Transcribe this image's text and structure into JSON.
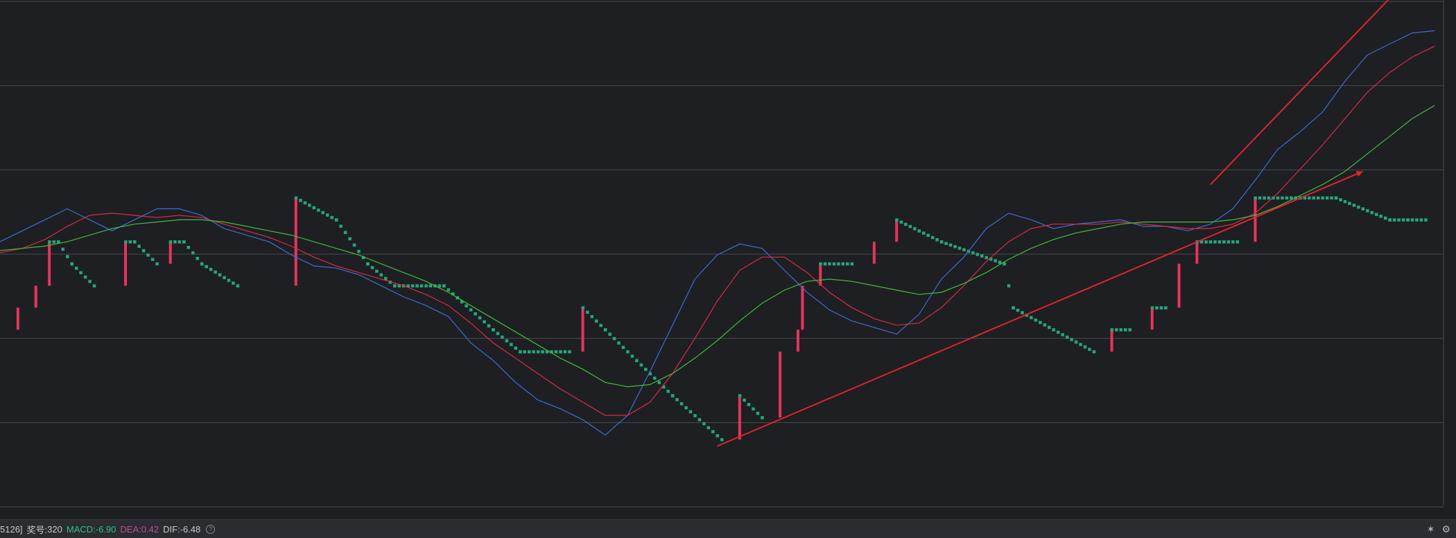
{
  "status_bar": {
    "prefix": "5126]",
    "issue_label": "奖号:",
    "issue_value": "320",
    "macd_label": "MACD:",
    "macd_value": "-6.90",
    "dea_label": "DEA:",
    "dea_value": "0.42",
    "dif_label": "DIF:",
    "dif_value": "-6.48",
    "help_glyph": "?",
    "pin_glyph": "✶",
    "settings_glyph": "⚙"
  },
  "colors": {
    "background": "#1e1f23",
    "grid": "#4a4b50",
    "up_bar": "#e8335a",
    "down_step": "#22a87c",
    "ma_fast": "#3b6fd8",
    "ma_mid": "#e02a45",
    "ma_slow": "#3fbf3a",
    "trend_line": "#e0242c"
  },
  "chart_data": {
    "type": "line",
    "title": "",
    "xlabel": "",
    "ylabel": "",
    "grid": true,
    "ylim": [
      -10,
      13
    ],
    "x": [
      0,
      5,
      10,
      15,
      20,
      25,
      30,
      35,
      40,
      45,
      50,
      55,
      60,
      65,
      70,
      75,
      80,
      85,
      90,
      95,
      100,
      105,
      110,
      115,
      120,
      125,
      130,
      135,
      140,
      145,
      150,
      155,
      160,
      165,
      170,
      175,
      180,
      185,
      190,
      195,
      200,
      205,
      210,
      215,
      220,
      225,
      230,
      235,
      240,
      245,
      250,
      255,
      260,
      265,
      270,
      275,
      280,
      285,
      290,
      295,
      300,
      305,
      310,
      315,
      320
    ],
    "series": [
      {
        "name": "",
        "values": [
          2,
          2.5,
          3,
          3.5,
          3,
          2.5,
          3,
          3.5,
          3.5,
          3.2,
          2.6,
          2.3,
          2,
          1.4,
          0.9,
          0.8,
          0.5,
          0.0,
          -0.5,
          -0.9,
          -1.4,
          -2.6,
          -3.4,
          -4.4,
          -5.2,
          -5.6,
          -6.1,
          -6.8,
          -5.9,
          -3.9,
          -1.8,
          0.3,
          1.4,
          1.9,
          1.7,
          0.7,
          -0.3,
          -1.1,
          -1.6,
          -1.9,
          -2.2,
          -1.3,
          0.3,
          1.3,
          2.6,
          3.3,
          3.0,
          2.6,
          2.8,
          2.9,
          3.0,
          2.7,
          2.7,
          2.5,
          2.8,
          3.5,
          4.8,
          6.2,
          7.0,
          7.9,
          9.3,
          10.5,
          11.0,
          11.5,
          11.6
        ]
      },
      {
        "name": "",
        "values": [
          1.5,
          1.7,
          2.1,
          2.7,
          3.2,
          3.3,
          3.2,
          3.1,
          3.2,
          3.1,
          2.8,
          2.5,
          2.2,
          1.8,
          1.3,
          0.9,
          0.6,
          0.3,
          0.0,
          -0.4,
          -0.9,
          -1.7,
          -2.6,
          -3.3,
          -4.0,
          -4.7,
          -5.3,
          -5.9,
          -5.9,
          -5.3,
          -4.0,
          -2.4,
          -0.7,
          0.7,
          1.3,
          1.3,
          0.6,
          -0.3,
          -1.0,
          -1.5,
          -1.8,
          -1.7,
          -1.0,
          0.0,
          1.1,
          2.0,
          2.6,
          2.8,
          2.8,
          2.8,
          2.9,
          2.8,
          2.7,
          2.6,
          2.6,
          2.8,
          3.3,
          4.2,
          5.3,
          6.4,
          7.6,
          8.8,
          9.7,
          10.4,
          10.9
        ]
      },
      {
        "name": "",
        "values": [
          1.6,
          1.7,
          1.8,
          2.0,
          2.3,
          2.6,
          2.8,
          2.9,
          3.0,
          3.0,
          2.9,
          2.7,
          2.5,
          2.3,
          2.0,
          1.7,
          1.4,
          1.0,
          0.6,
          0.2,
          -0.3,
          -0.9,
          -1.5,
          -2.1,
          -2.7,
          -3.3,
          -3.8,
          -4.4,
          -4.6,
          -4.5,
          -4.0,
          -3.3,
          -2.5,
          -1.6,
          -0.8,
          -0.2,
          0.2,
          0.3,
          0.2,
          0.0,
          -0.2,
          -0.4,
          -0.3,
          0.1,
          0.6,
          1.2,
          1.7,
          2.1,
          2.4,
          2.6,
          2.8,
          2.9,
          2.9,
          2.9,
          2.9,
          3.0,
          3.2,
          3.6,
          4.1,
          4.6,
          5.2,
          6.0,
          6.8,
          7.6,
          8.2
        ]
      }
    ],
    "renko": {
      "box_size": 0.5,
      "steps": [
        [
          0,
          -2
        ],
        [
          4,
          -1
        ],
        [
          8,
          0
        ],
        [
          11,
          2
        ],
        [
          13,
          2
        ],
        [
          16,
          1
        ],
        [
          21,
          0
        ],
        [
          28,
          2
        ],
        [
          30,
          2
        ],
        [
          35,
          1
        ],
        [
          38,
          2
        ],
        [
          41,
          2
        ],
        [
          45,
          1
        ],
        [
          53,
          0
        ],
        [
          66,
          4
        ],
        [
          75,
          3
        ],
        [
          82,
          1
        ],
        [
          88,
          0
        ],
        [
          99,
          0
        ],
        [
          110,
          -2
        ],
        [
          116,
          -3
        ],
        [
          127,
          -3
        ],
        [
          130,
          -1
        ],
        [
          135,
          -2
        ],
        [
          150,
          -5
        ],
        [
          161,
          -7
        ],
        [
          165,
          -5
        ],
        [
          170,
          -6
        ],
        [
          174,
          -3
        ],
        [
          178,
          -2
        ],
        [
          179,
          0
        ],
        [
          183,
          1
        ],
        [
          190,
          1
        ],
        [
          195,
          2
        ],
        [
          200,
          3
        ],
        [
          210,
          2
        ],
        [
          224,
          1
        ],
        [
          226,
          -1
        ],
        [
          244,
          -3
        ],
        [
          248,
          -2
        ],
        [
          252,
          -2
        ],
        [
          257,
          -1
        ],
        [
          260,
          -1
        ],
        [
          263,
          1
        ],
        [
          267,
          2
        ],
        [
          276,
          2
        ],
        [
          280,
          4
        ],
        [
          290,
          4
        ],
        [
          298,
          4
        ],
        [
          310,
          3
        ],
        [
          314,
          3
        ],
        [
          318,
          3
        ]
      ]
    },
    "trend_lines": [
      {
        "from": [
          160,
          -7.3
        ],
        "to": [
          304,
          5.2
        ]
      },
      {
        "from": [
          270,
          4.6
        ],
        "to": [
          312,
          13.5
        ]
      }
    ]
  }
}
